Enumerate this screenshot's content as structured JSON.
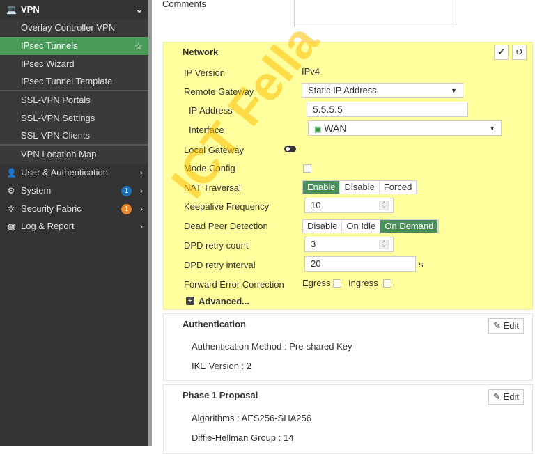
{
  "sidebar": {
    "vpn": "VPN",
    "items": [
      "Overlay Controller VPN",
      "IPsec Tunnels",
      "IPsec Wizard",
      "IPsec Tunnel Template",
      "SSL-VPN Portals",
      "SSL-VPN Settings",
      "SSL-VPN Clients",
      "VPN Location Map"
    ],
    "sections": [
      {
        "label": "User & Authentication"
      },
      {
        "label": "System",
        "badge": "1"
      },
      {
        "label": "Security Fabric",
        "badge": "1"
      },
      {
        "label": "Log & Report"
      }
    ]
  },
  "comments_label": "Comments",
  "network": {
    "title": "Network",
    "ip_version_label": "IP Version",
    "ip_version": "IPv4",
    "remote_gateway_label": "Remote Gateway",
    "remote_gateway": "Static IP Address",
    "ip_address_label": "IP Address",
    "ip_address": "5.5.5.5",
    "interface_label": "Interface",
    "interface": "WAN",
    "local_gateway_label": "Local Gateway",
    "mode_config_label": "Mode Config",
    "nat_label": "NAT Traversal",
    "nat_options": [
      "Enable",
      "Disable",
      "Forced"
    ],
    "keepalive_label": "Keepalive Frequency",
    "keepalive": "10",
    "dpd_label": "Dead Peer Detection",
    "dpd_options": [
      "Disable",
      "On Idle",
      "On Demand"
    ],
    "dpd_count_label": "DPD retry count",
    "dpd_count": "3",
    "dpd_interval_label": "DPD retry interval",
    "dpd_interval": "20",
    "dpd_unit": "s",
    "fec_label": "Forward Error Correction",
    "egress": "Egress",
    "ingress": "Ingress",
    "advanced": "Advanced..."
  },
  "auth": {
    "title": "Authentication",
    "edit": "Edit",
    "method": "Authentication Method : Pre-shared Key",
    "ike": "IKE Version : 2"
  },
  "phase1": {
    "title": "Phase 1 Proposal",
    "edit": "Edit",
    "algorithms": "Algorithms : AES256-SHA256",
    "dh": "Diffie-Hellman Group : 14"
  },
  "watermark": "ICT Fella",
  "colors": {
    "accent": "#4a9a5a",
    "panel": "#ffff9e",
    "sidebar": "#333333"
  }
}
